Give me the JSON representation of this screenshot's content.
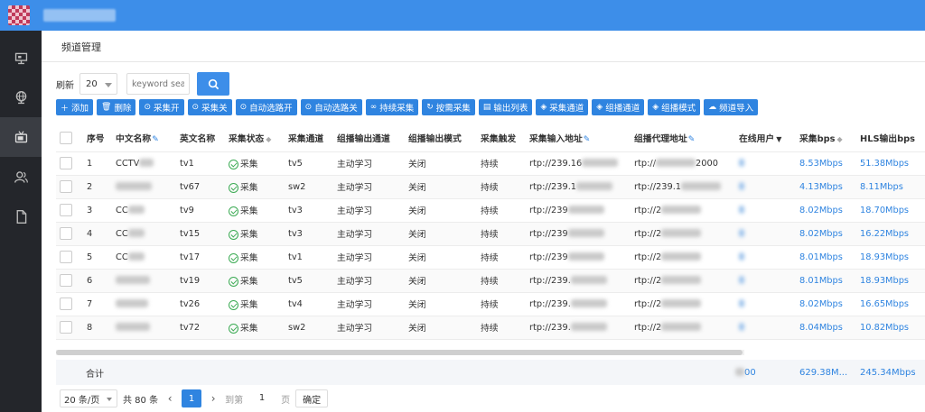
{
  "header": {
    "title": "频道管理"
  },
  "toolbar": {
    "refresh_label": "刷新",
    "refresh_value": "20",
    "search_placeholder": "keyword sea",
    "buttons": [
      "添加",
      "删除",
      "采集开",
      "采集关",
      "自动选路开",
      "自动选路关",
      "持续采集",
      "按需采集",
      "输出列表",
      "采集通道",
      "组播通道",
      "组播模式",
      "频道导入"
    ]
  },
  "table": {
    "columns": [
      "序号",
      "中文名称",
      "英文名称",
      "采集状态",
      "采集通道",
      "组播输出通道",
      "组播输出模式",
      "采集触发",
      "采集输入地址",
      "组播代理地址",
      "在线用户",
      "采集bps",
      "HLS输出bps"
    ],
    "rows": [
      {
        "no": "1",
        "cn": "CCTV",
        "en": "tv1",
        "status": "采集",
        "channel": "tv5",
        "out_channel": "主动学习",
        "out_mode": "关闭",
        "trigger": "持续",
        "input": "rtp://239.16",
        "proxy": "rtp://",
        "proxy_tail": "2000",
        "bps": "8.53Mbps",
        "hls": "51.38Mbps"
      },
      {
        "no": "2",
        "cn": "",
        "en": "tv67",
        "status": "采集",
        "channel": "sw2",
        "out_channel": "主动学习",
        "out_mode": "关闭",
        "trigger": "持续",
        "input": "rtp://239.1",
        "proxy": "rtp://239.1",
        "proxy_tail": "",
        "bps": "4.13Mbps",
        "hls": "8.11Mbps"
      },
      {
        "no": "3",
        "cn": "CC",
        "en": "tv9",
        "status": "采集",
        "channel": "tv3",
        "out_channel": "主动学习",
        "out_mode": "关闭",
        "trigger": "持续",
        "input": "rtp://239",
        "proxy": "rtp://2",
        "proxy_tail": "",
        "bps": "8.02Mbps",
        "hls": "18.70Mbps"
      },
      {
        "no": "4",
        "cn": "CC",
        "en": "tv15",
        "status": "采集",
        "channel": "tv3",
        "out_channel": "主动学习",
        "out_mode": "关闭",
        "trigger": "持续",
        "input": "rtp://239",
        "proxy": "rtp://2",
        "proxy_tail": "",
        "bps": "8.02Mbps",
        "hls": "16.22Mbps"
      },
      {
        "no": "5",
        "cn": "CC",
        "en": "tv17",
        "status": "采集",
        "channel": "tv1",
        "out_channel": "主动学习",
        "out_mode": "关闭",
        "trigger": "持续",
        "input": "rtp://239",
        "proxy": "rtp://2",
        "proxy_tail": "",
        "bps": "8.01Mbps",
        "hls": "18.93Mbps"
      },
      {
        "no": "6",
        "cn": "",
        "en": "tv19",
        "status": "采集",
        "channel": "tv5",
        "out_channel": "主动学习",
        "out_mode": "关闭",
        "trigger": "持续",
        "input": "rtp://239.",
        "proxy": "rtp://2",
        "proxy_tail": "",
        "bps": "8.01Mbps",
        "hls": "18.93Mbps"
      },
      {
        "no": "7",
        "cn": "",
        "en": "tv26",
        "status": "采集",
        "channel": "tv4",
        "out_channel": "主动学习",
        "out_mode": "关闭",
        "trigger": "持续",
        "input": "rtp://239.",
        "proxy": "rtp://2",
        "proxy_tail": "",
        "bps": "8.02Mbps",
        "hls": "16.65Mbps"
      },
      {
        "no": "8",
        "cn": "",
        "en": "tv72",
        "status": "采集",
        "channel": "sw2",
        "out_channel": "主动学习",
        "out_mode": "关闭",
        "trigger": "持续",
        "input": "rtp://239.",
        "proxy": "rtp://2",
        "proxy_tail": "",
        "bps": "8.04Mbps",
        "hls": "10.82Mbps"
      }
    ],
    "total": {
      "label": "合计",
      "users": "00",
      "bps": "629.38M...",
      "hls": "245.34Mbps"
    }
  },
  "pager": {
    "page_size": "20 条/页",
    "total": "共 80 条",
    "current": "1",
    "goto_label": "到第",
    "goto_value": "1",
    "page_unit": "页",
    "confirm": "确定"
  },
  "colors": {
    "accent": "#3d8ee9",
    "button": "#2f84e0",
    "sidebar": "#24262b",
    "ok": "#3cab54"
  }
}
